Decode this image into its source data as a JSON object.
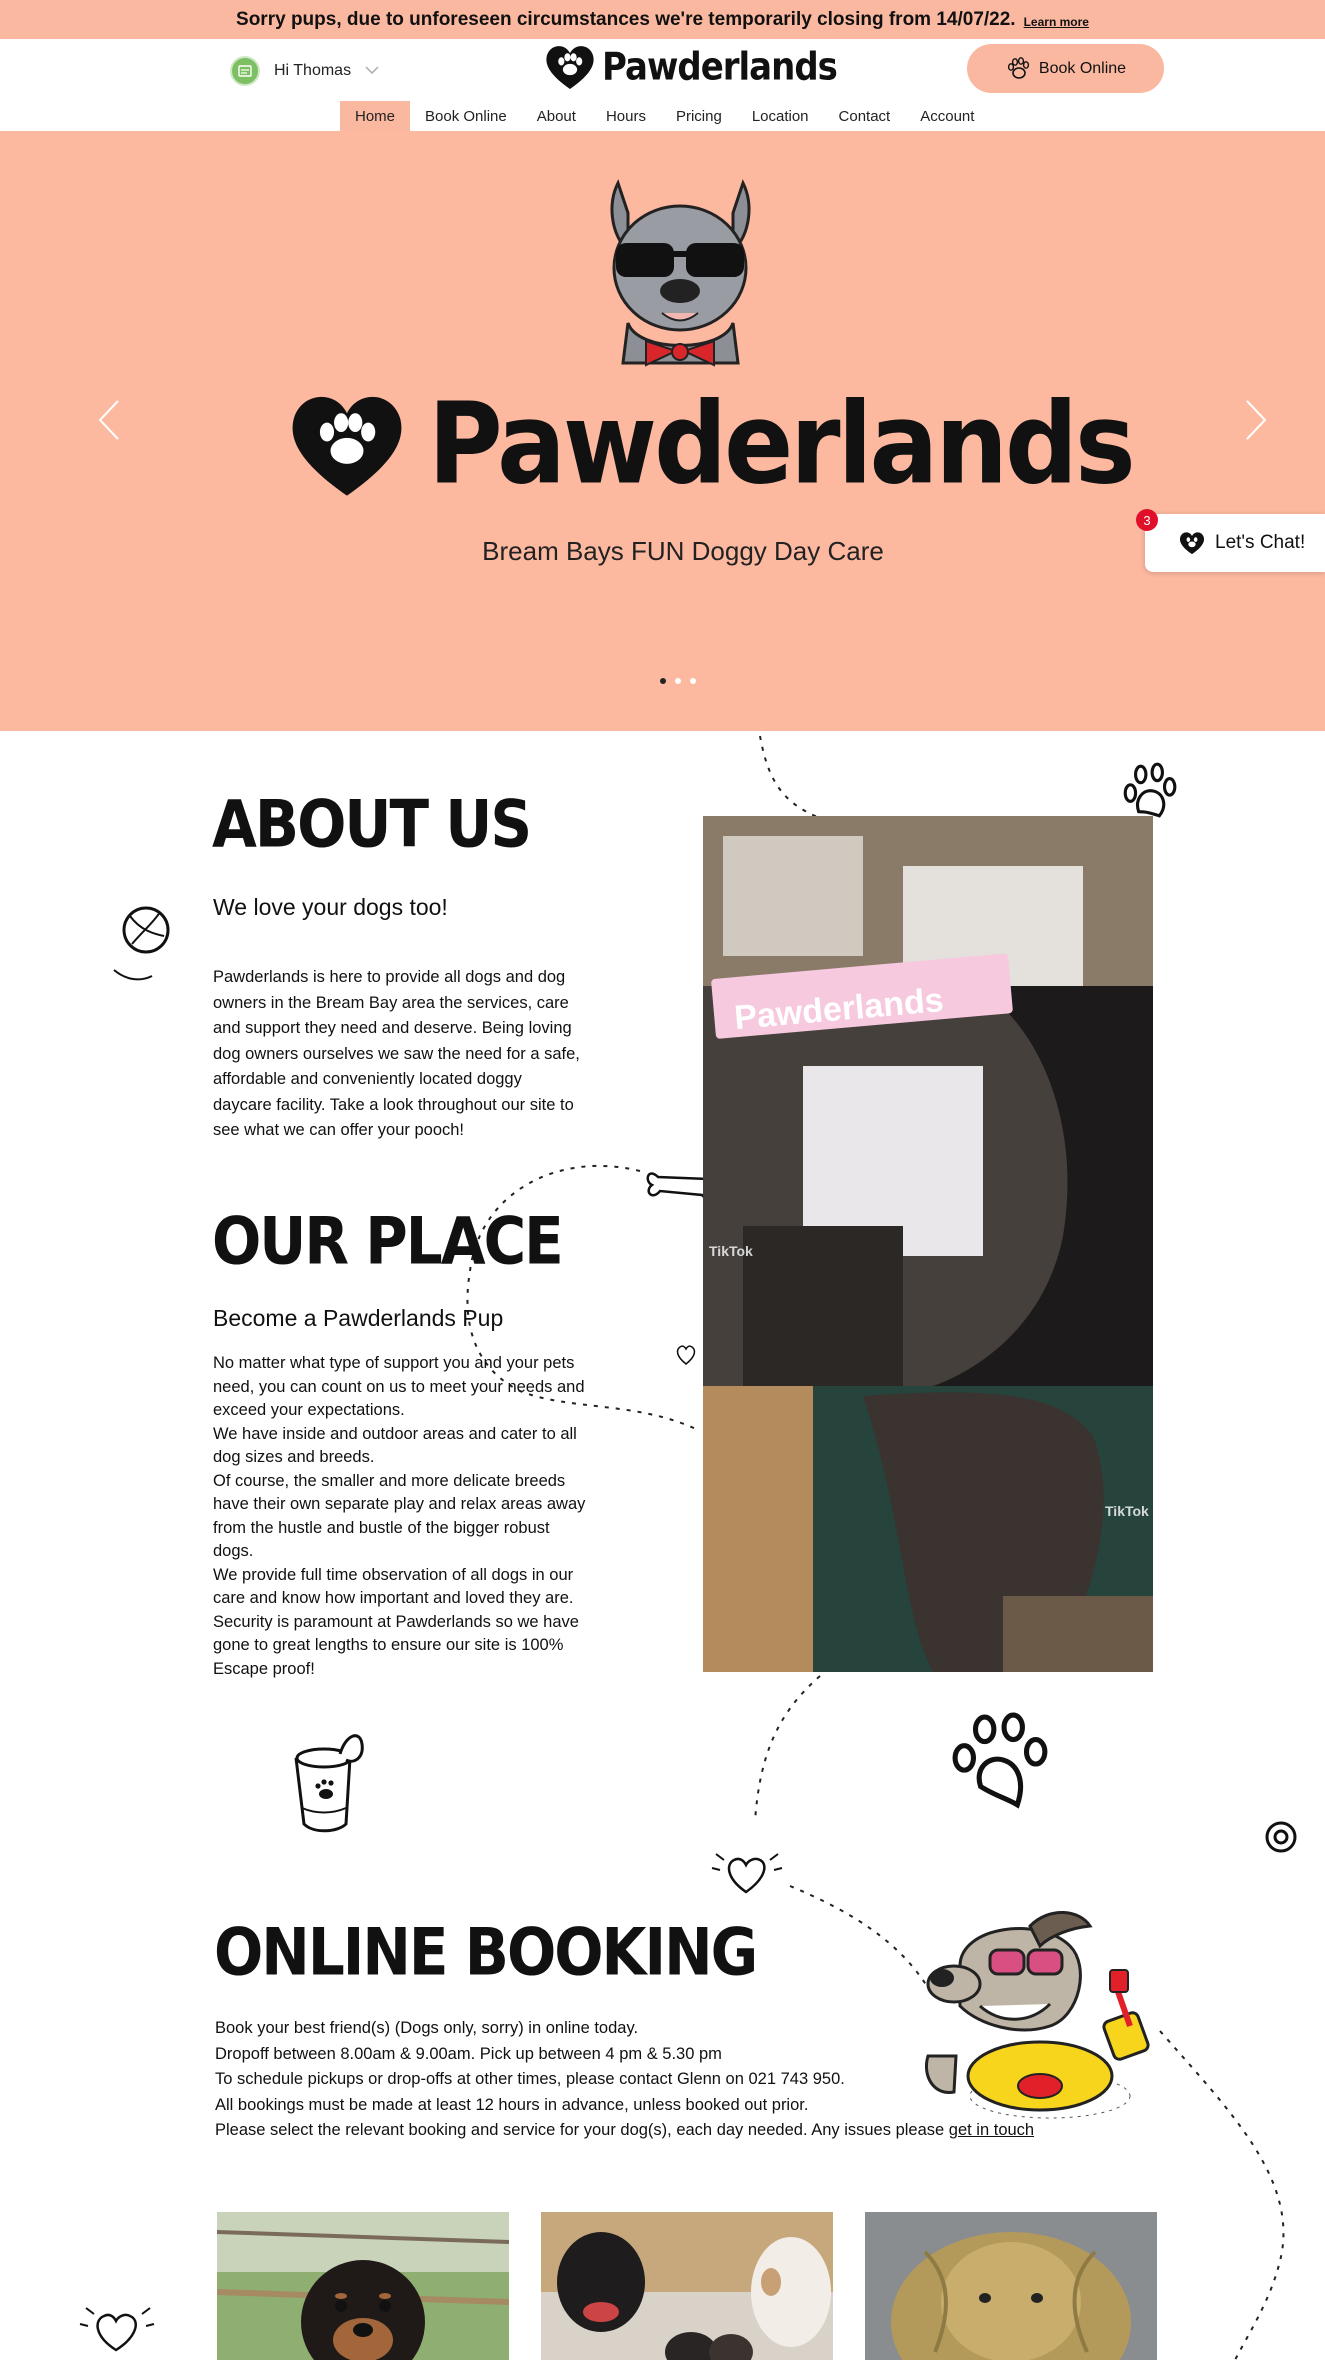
{
  "announcement": {
    "message": "Sorry pups, due to unforeseen circumstances we're temporarily closing from 14/07/22.",
    "link": "Learn more"
  },
  "header": {
    "user_greeting": "Hi Thomas",
    "logo_text": "Pawderlands",
    "book_button": "Book Online"
  },
  "nav": {
    "items": [
      "Home",
      "Book Online",
      "About",
      "Hours",
      "Pricing",
      "Location",
      "Contact",
      "Account"
    ],
    "active": "Home"
  },
  "hero": {
    "title": "Pawderlands",
    "tagline": "Bream Bays FUN Doggy Day Care",
    "slide_count": 3,
    "active_slide": 1
  },
  "chat": {
    "label": "Let's Chat!",
    "unread": "3"
  },
  "about": {
    "heading": "ABOUT US",
    "subheading": "We love your dogs too!",
    "body": [
      "Pawderlands is here  to provide all dogs and dog",
      "owners in the Bream Bay area the services, care",
      "and support they need and deserve. Being loving",
      "dog owners ourselves we saw the need for a safe,",
      "affordable and conveniently located doggy",
      "daycare facility. Take a look throughout our site to",
      "see what we can offer your pooch!"
    ]
  },
  "our_place": {
    "heading": "OUR PLACE",
    "subheading": "Become a Pawderlands Pup",
    "body": [
      "No matter what type of support you and your pets",
      "need, you can count on us to meet your needs and",
      "exceed your expectations.",
      "We have inside and outdoor areas and cater to all",
      "dog sizes and breeds.",
      "Of course, the smaller and more delicate breeds",
      "have their own separate play and relax areas away",
      "from the hustle and bustle of the bigger robust",
      "dogs.",
      "We provide full time observation of all dogs in our",
      "care and know how important and loved they are.",
      "Security is paramount at Pawderlands so we have",
      "gone to great lengths to ensure our site is 100%",
      "Escape proof!"
    ]
  },
  "video": {
    "overlay_text": "Pawderlands",
    "watermark": "TikTok"
  },
  "booking": {
    "heading": "ONLINE BOOKING",
    "lines": [
      "Book your best friend(s) (Dogs only, sorry) in online today.",
      "Dropoff between 8.00am & 9.00am. Pick up between 4 pm & 5.30 pm",
      "To schedule pickups or drop-offs at other times, please contact Glenn on 021 743 950.",
      "All bookings must be made at least 12 hours in advance, unless booked out prior."
    ],
    "last_line": "Please select the relevant booking and service for your dog(s), each day needed. Any issues please ",
    "contact_link": "get in touch"
  },
  "colors": {
    "brand_peach": "#fdb8a0",
    "ink": "#111111"
  }
}
